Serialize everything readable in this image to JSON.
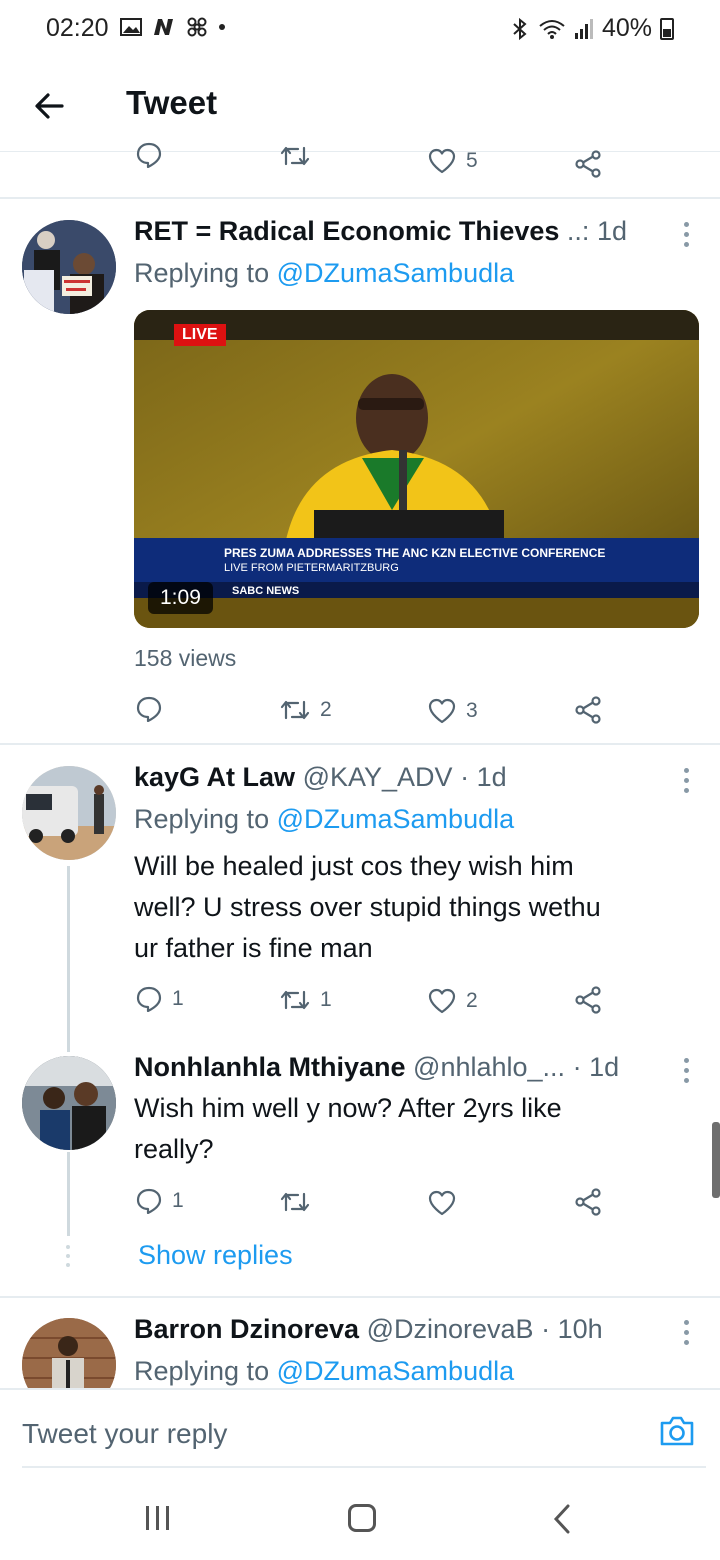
{
  "status_bar": {
    "time": "02:20",
    "battery": "40%"
  },
  "header": {
    "title": "Tweet"
  },
  "top_actions": {
    "likes": "5"
  },
  "tweets": [
    {
      "name": "RET = Radical Economic Thieves",
      "handle_suffix": "..:",
      "time": "1d",
      "replying_label": "Replying to",
      "replying_handle": "@DZumaSambudla",
      "video": {
        "live_badge": "LIVE",
        "banner_line1": "PRES ZUMA ADDRESSES THE ANC KZN ELECTIVE CONFERENCE",
        "banner_line2": "LIVE FROM PIETERMARITZBURG",
        "channel": "SABC NEWS",
        "duration": "1:09"
      },
      "views": "158 views",
      "retweets": "2",
      "likes": "3"
    },
    {
      "name": "kayG At Law",
      "handle": "@KAY_ADV",
      "time": "1d",
      "replying_label": "Replying to",
      "replying_handle": "@DZumaSambudla",
      "text_line1": "Will be healed just cos they wish him",
      "text_line2": "well? U stress over stupid things wethu",
      "text_line3": "ur father is fine man",
      "replies": "1",
      "retweets": "1",
      "likes": "2"
    },
    {
      "name": "Nonhlanhla Mthiyane",
      "handle": "@nhlahlo_...",
      "time": "1d",
      "text_line1": "Wish him well y now? After 2yrs like",
      "text_line2": "really?",
      "replies": "1"
    },
    {
      "name": "Barron Dzinoreva",
      "handle": "@DzinorevaB",
      "time": "10h",
      "replying_label": "Replying to",
      "replying_handle": "@DZumaSambudla"
    }
  ],
  "show_replies": "Show replies",
  "compose": {
    "placeholder": "Tweet your reply"
  },
  "colors": {
    "accent": "#1d9bf0",
    "secondary_text": "#536471"
  }
}
